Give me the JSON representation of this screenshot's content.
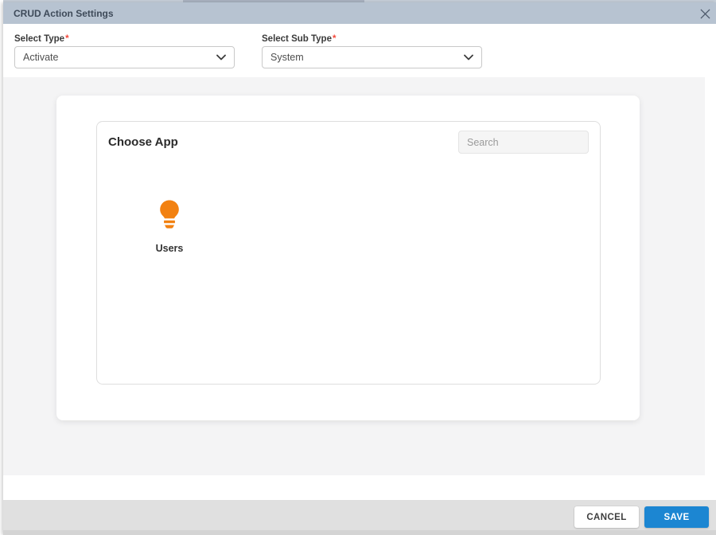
{
  "modal": {
    "title": "CRUD Action Settings"
  },
  "form": {
    "type": {
      "label": "Select Type",
      "required_marker": "*",
      "value": "Activate"
    },
    "sub_type": {
      "label": "Select Sub Type",
      "required_marker": "*",
      "value": "System"
    }
  },
  "app_chooser": {
    "heading": "Choose App",
    "search_placeholder": "Search",
    "apps": [
      {
        "name": "Users",
        "icon": "lightbulb-icon",
        "icon_color": "#F28111"
      }
    ]
  },
  "footer": {
    "cancel_label": "CANCEL",
    "save_label": "SAVE"
  },
  "colors": {
    "header_bg": "#B7C3D1",
    "header_text": "#3E4A59",
    "body_bg": "#F4F4F5",
    "footer_bg": "#E0E0E0",
    "save_blue": "#1C86D2",
    "icon_orange": "#F28111",
    "required_red": "#F4483A"
  }
}
